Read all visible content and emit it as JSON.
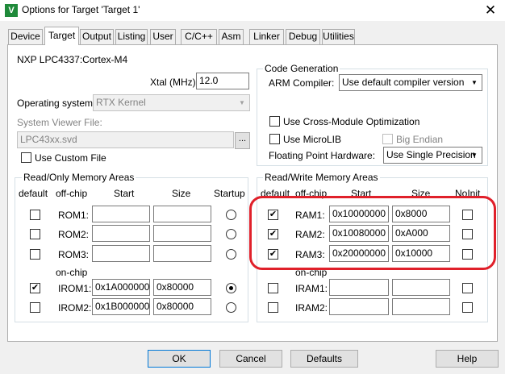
{
  "window": {
    "title": "Options for Target 'Target 1'",
    "app_icon": "keil-uvision-icon",
    "close": "✕"
  },
  "tabs": [
    {
      "label": "Device"
    },
    {
      "label": "Target"
    },
    {
      "label": "Output"
    },
    {
      "label": "Listing"
    },
    {
      "label": "User"
    },
    {
      "label": "C/C++"
    },
    {
      "label": "Asm"
    },
    {
      "label": "Linker"
    },
    {
      "label": "Debug"
    },
    {
      "label": "Utilities"
    }
  ],
  "target": {
    "device": "NXP LPC4337:Cortex-M4",
    "xtal_label": "Xtal (MHz):",
    "xtal_value": "12.0",
    "os_label": "Operating system:",
    "os_value": "RTX Kernel",
    "svf_label": "System Viewer File:",
    "svf_value": "LPC43xx.svd",
    "browse_label": "...",
    "custom_file_label": "Use Custom File"
  },
  "codegen": {
    "title": "Code Generation",
    "compiler_label": "ARM Compiler:",
    "compiler_value": "Use default compiler version",
    "cross_module_label": "Use Cross-Module Optimization",
    "microlib_label": "Use MicroLIB",
    "big_endian_label": "Big Endian",
    "fpu_label": "Floating Point Hardware:",
    "fpu_value": "Use Single Precision"
  },
  "rom_area": {
    "title": "Read/Only Memory Areas",
    "headers": {
      "default": "default",
      "offchip": "off-chip",
      "start": "Start",
      "size": "Size",
      "startup": "Startup"
    },
    "onchip_label": "on-chip",
    "rows": [
      {
        "name": "ROM1:",
        "start": "",
        "size": "",
        "default": false,
        "startup": false
      },
      {
        "name": "ROM2:",
        "start": "",
        "size": "",
        "default": false,
        "startup": false
      },
      {
        "name": "ROM3:",
        "start": "",
        "size": "",
        "default": false,
        "startup": false
      },
      {
        "name": "IROM1:",
        "start": "0x1A000000",
        "size": "0x80000",
        "default": true,
        "startup": true
      },
      {
        "name": "IROM2:",
        "start": "0x1B000000",
        "size": "0x80000",
        "default": false,
        "startup": false
      }
    ]
  },
  "ram_area": {
    "title": "Read/Write Memory Areas",
    "headers": {
      "default": "default",
      "offchip": "off-chip",
      "start": "Start",
      "size": "Size",
      "noinit": "NoInit"
    },
    "onchip_label": "on-chip",
    "rows": [
      {
        "name": "RAM1:",
        "start": "0x10000000",
        "size": "0x8000",
        "default": true,
        "noinit": false
      },
      {
        "name": "RAM2:",
        "start": "0x10080000",
        "size": "0xA000",
        "default": true,
        "noinit": false
      },
      {
        "name": "RAM3:",
        "start": "0x20000000",
        "size": "0x10000",
        "default": true,
        "noinit": false
      },
      {
        "name": "IRAM1:",
        "start": "",
        "size": "",
        "default": false,
        "noinit": false
      },
      {
        "name": "IRAM2:",
        "start": "",
        "size": "",
        "default": false,
        "noinit": false
      }
    ]
  },
  "buttons": {
    "ok": "OK",
    "cancel": "Cancel",
    "defaults": "Defaults",
    "help": "Help"
  },
  "colors": {
    "highlight": "#e0202a",
    "dialog_bg": "#f0f0f0",
    "focus_border": "#0078d7"
  },
  "glyphs": {
    "check": "✔",
    "dropdown": "▼"
  }
}
